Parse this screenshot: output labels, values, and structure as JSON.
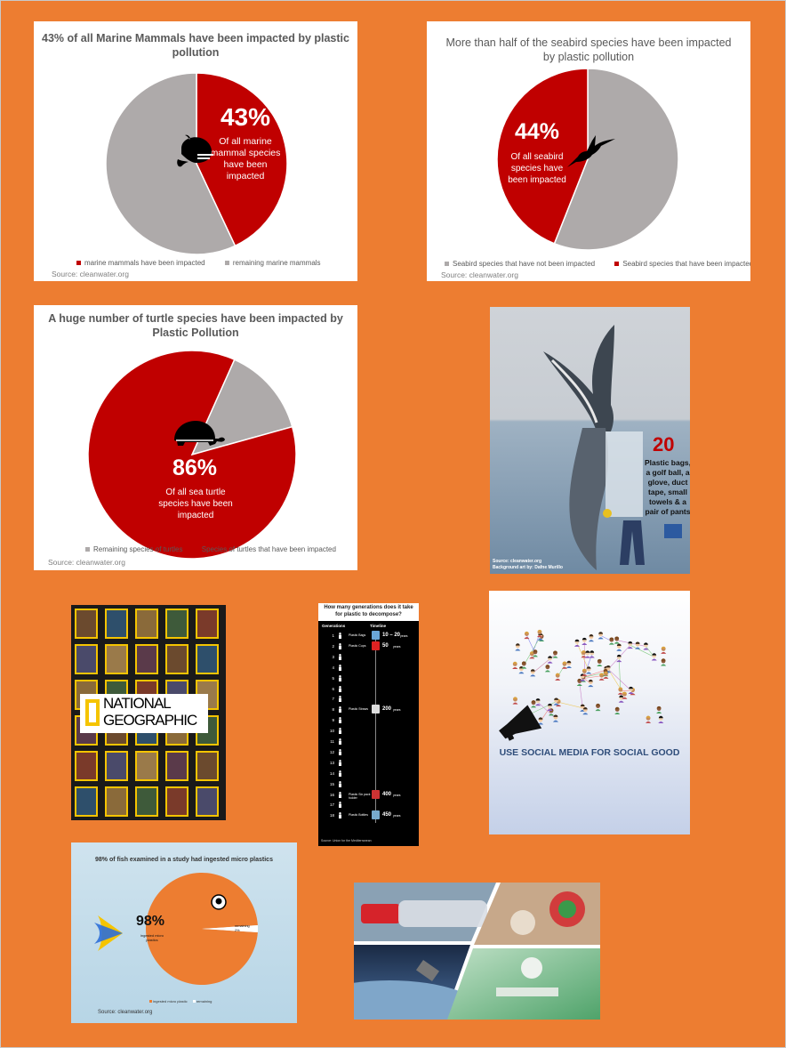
{
  "colors": {
    "background": "#ed7d31",
    "impacted": "#c00000",
    "remaining": "#aeaaaa",
    "fish_orange": "#ed7d31"
  },
  "chart_data": [
    {
      "type": "pie",
      "title": "43% of all Marine Mammals have been impacted by plastic pollution",
      "slices": [
        {
          "label": "marine mammals have been impacted",
          "value": 43
        },
        {
          "label": "remaining marine mammals",
          "value": 57
        }
      ],
      "big_label": "43%",
      "sub_label": "Of all marine mammal species have been impacted",
      "source": "Source: cleanwater.org"
    },
    {
      "type": "pie",
      "title": "More than half of the seabird species have been impacted by plastic pollution",
      "slices": [
        {
          "label": "Seabird species that have not been impacted",
          "value": 56
        },
        {
          "label": "Seabird species that  have been impacted",
          "value": 44
        }
      ],
      "big_label": "44%",
      "sub_label": "Of all seabird species have been impacted",
      "source": "Source: cleanwater.org"
    },
    {
      "type": "pie",
      "title": "A huge number of turtle species have been impacted by Plastic Pollution",
      "slices": [
        {
          "label": "Remaining species of turtles",
          "value": 14
        },
        {
          "label": "Species of turtles that have been impacted",
          "value": 86
        }
      ],
      "big_label": "86%",
      "sub_label": "Of all sea turtle species have been impacted",
      "source": "Source: cleanwater.org"
    },
    {
      "type": "pie",
      "title": "98% of fish examined in a study had ingested micro plastics",
      "slices": [
        {
          "label": "ingested micro plastic",
          "value": 98
        },
        {
          "label": "remaining",
          "value": 2
        }
      ],
      "big_label": "98%",
      "sub_label": "ingested micro plastics",
      "slice_note": "remaining 2%",
      "source": "Source: cleanwater.org"
    }
  ],
  "whale_poster": {
    "number": "20",
    "text": "Plastic bags, a golf ball, a glove, duct tape, small towels & a pair of pants",
    "credit1": "Source: cleanwater.org",
    "credit2": "Background art by: Dafne Murillo"
  },
  "natgeo": {
    "text1": "NATIONAL",
    "text2": "GEOGRAPHIC"
  },
  "decompose": {
    "title": "How many generations does it take for plastic to decompose?",
    "col1": "Generations",
    "col2": "Timeline",
    "generations": [
      "1",
      "2",
      "3",
      "4",
      "5",
      "6",
      "7",
      "8",
      "9",
      "10",
      "11",
      "12",
      "13",
      "14",
      "15",
      "16",
      "17",
      "18"
    ],
    "items": [
      {
        "gen": 1,
        "label": "Plastic Bags",
        "years": "10 – 20",
        "unit": "years"
      },
      {
        "gen": 2,
        "label": "Plastic Cups",
        "years": "50",
        "unit": "years"
      },
      {
        "gen": 8,
        "label": "Plastic Straws",
        "years": "200",
        "unit": "years"
      },
      {
        "gen": 16,
        "label": "Plastic Six pack holder",
        "years": "400",
        "unit": "years"
      },
      {
        "gen": 18,
        "label": "Plastic Bottles",
        "years": "450",
        "unit": "years"
      }
    ],
    "source": "Source: Union for the Mediterranean"
  },
  "social": {
    "text": "USE SOCIAL MEDIA FOR SOCIAL GOOD"
  }
}
